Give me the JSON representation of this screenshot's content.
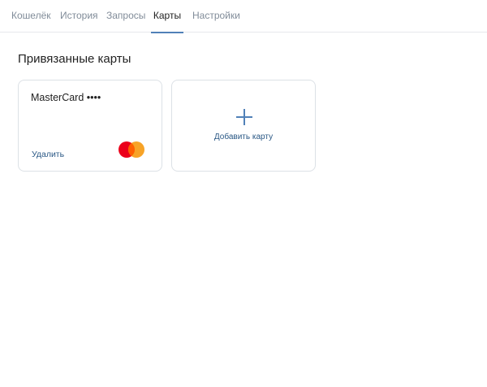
{
  "tabs": [
    {
      "label": "Кошелёк",
      "active": false
    },
    {
      "label": "История",
      "active": false
    },
    {
      "label": "Запросы",
      "active": false
    },
    {
      "label": "Карты",
      "active": true
    },
    {
      "label": "Настройки",
      "active": false
    }
  ],
  "main": {
    "title": "Привязанные карты",
    "cards": [
      {
        "name": "MasterCard ••••",
        "remove_label": "Удалить",
        "logo_icon": "mastercard-logo-icon"
      }
    ],
    "add_card": {
      "label": "Добавить карту",
      "icon": "plus-icon"
    }
  },
  "colors": {
    "accent": "#5181b8",
    "link": "#2a5885",
    "tab_inactive": "#818c99",
    "border": "#dce1e6",
    "mastercard_red": "#eb001b",
    "mastercard_orange": "#f79e1b"
  }
}
